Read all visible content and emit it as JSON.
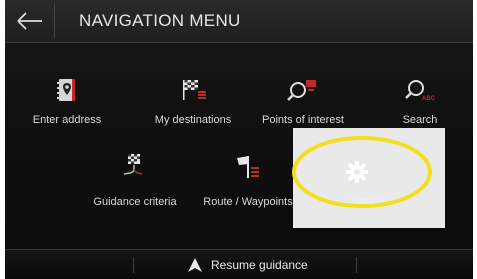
{
  "header": {
    "title": "NAVIGATION MENU"
  },
  "tiles": [
    {
      "label": "Enter address"
    },
    {
      "label": "My destinations"
    },
    {
      "label": "Points of interest"
    },
    {
      "label": "Search",
      "icon_text": "ABC"
    },
    {
      "label": "Guidance criteria"
    },
    {
      "label": "Route / Waypoints"
    },
    {
      "label": "Settings"
    }
  ],
  "bottom": {
    "resume_label": "Resume guidance"
  },
  "colors": {
    "accent": "#c0282d",
    "highlight": "#f2df22"
  }
}
